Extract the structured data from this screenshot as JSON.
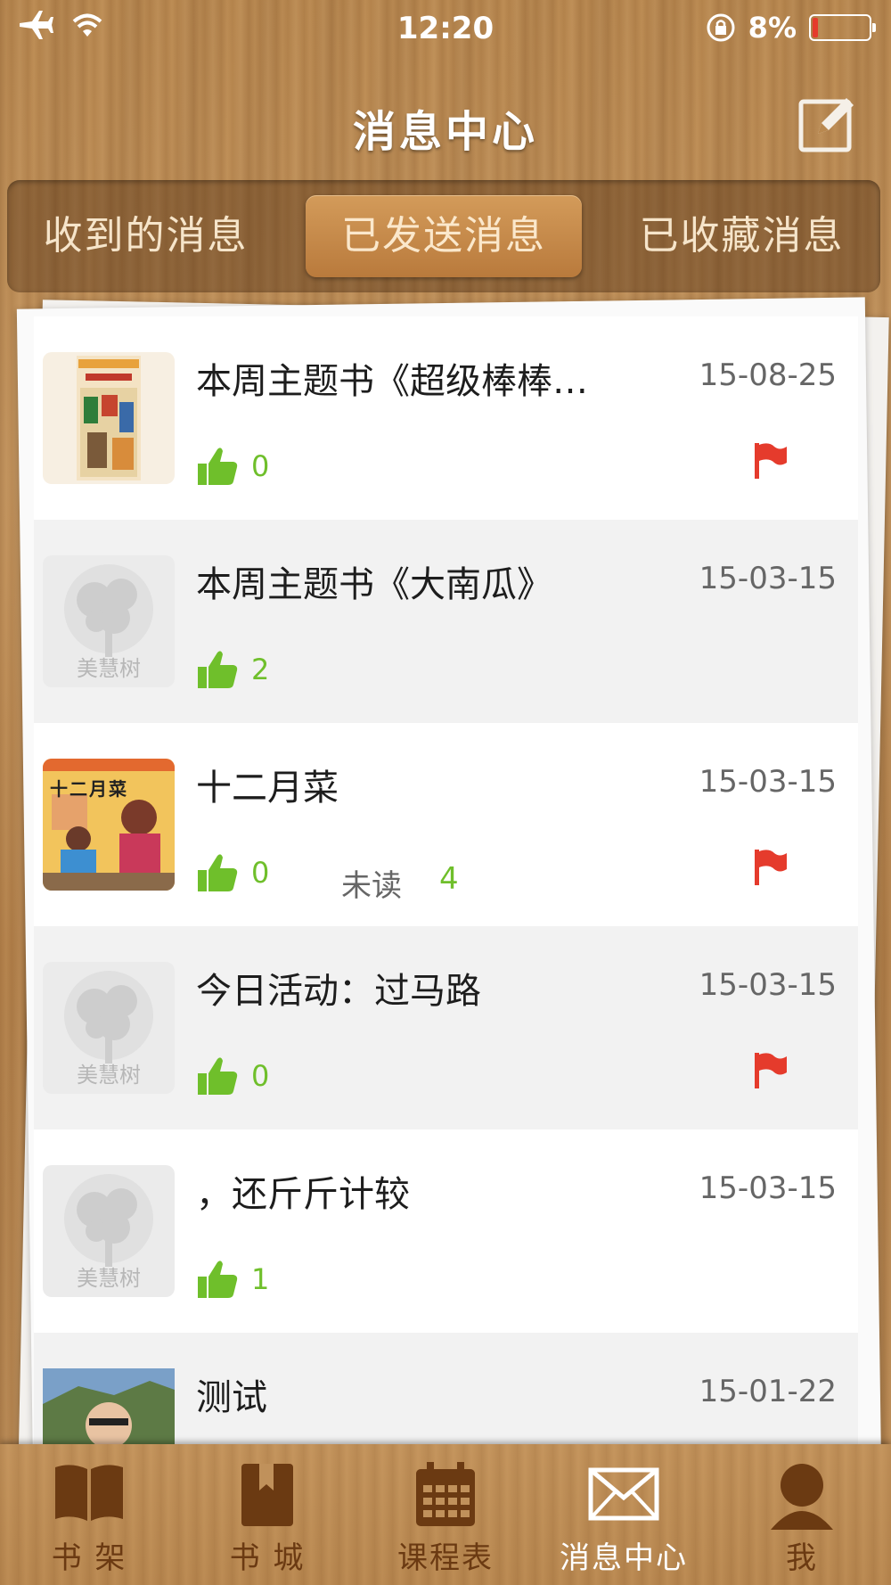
{
  "status": {
    "time": "12:20",
    "battery": "8%"
  },
  "header": {
    "title": "消息中心"
  },
  "segments": [
    {
      "label": "收到的消息",
      "active": false
    },
    {
      "label": "已发送消息",
      "active": true
    },
    {
      "label": "已收藏消息",
      "active": false
    }
  ],
  "placeholder_text": "美慧树",
  "messages": [
    {
      "title": "本周主题书《超级棒棒…",
      "date": "15-08-25",
      "likes": "0",
      "flag": true,
      "thumb": "book-cover"
    },
    {
      "title": "本周主题书《大南瓜》",
      "date": "15-03-15",
      "likes": "2",
      "flag": false,
      "thumb": "placeholder"
    },
    {
      "title": "十二月菜",
      "date": "15-03-15",
      "likes": "0",
      "unread_label": "未读",
      "unread_count": "4",
      "flag": true,
      "thumb": "book-cover",
      "thumb_text": "十二月菜"
    },
    {
      "title": "今日活动：过马路",
      "date": "15-03-15",
      "likes": "0",
      "flag": true,
      "thumb": "placeholder"
    },
    {
      "title": "，还斤斤计较",
      "date": "15-03-15",
      "likes": "1",
      "flag": false,
      "thumb": "placeholder"
    },
    {
      "title": "测试",
      "date": "15-01-22",
      "thumb": "photo"
    }
  ],
  "tabs": [
    {
      "label": "书 架",
      "icon": "book-icon"
    },
    {
      "label": "书 城",
      "icon": "bookmark-book-icon"
    },
    {
      "label": "课程表",
      "icon": "calendar-icon"
    },
    {
      "label": "消息中心",
      "icon": "envelope-icon",
      "active": true
    },
    {
      "label": "我",
      "icon": "user-icon"
    }
  ],
  "colors": {
    "accent_green": "#6fbf2b",
    "flag_red": "#e53b2c",
    "wood": "#b9884f"
  }
}
